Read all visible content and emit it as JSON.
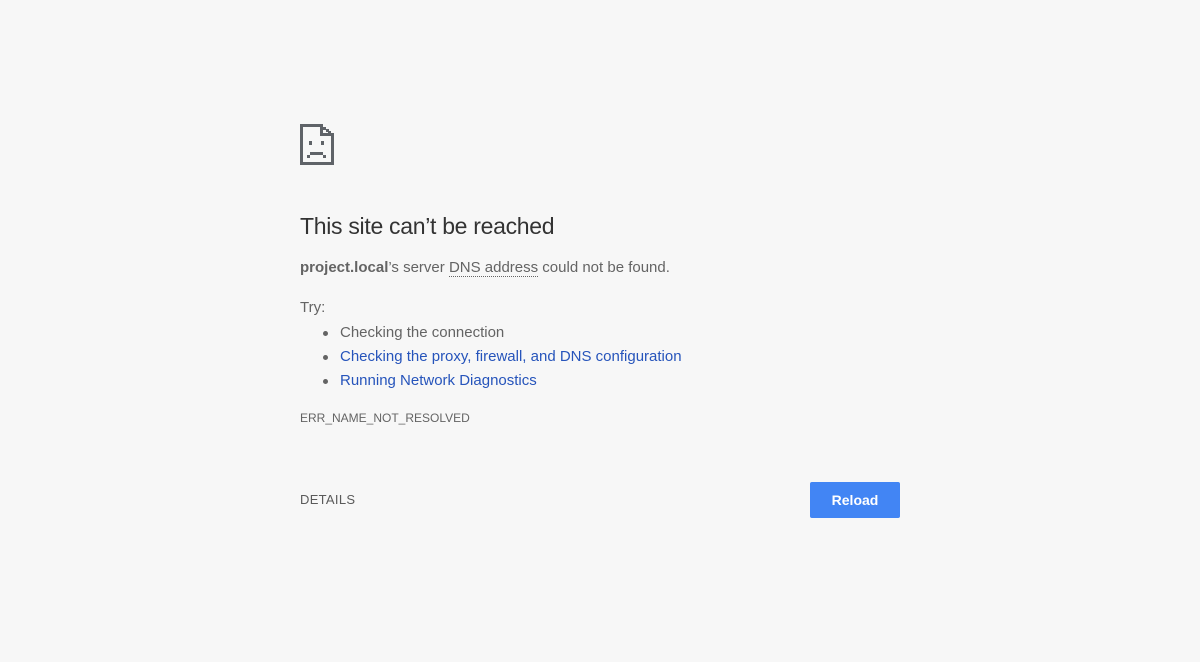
{
  "error_page": {
    "icon": "sad-document-icon",
    "heading": "This site can’t be reached",
    "summary": {
      "host": "project.local",
      "middle": "’s server ",
      "abbr": "DNS address",
      "tail": " could not be found."
    },
    "try_label": "Try:",
    "suggestions": [
      {
        "label": "Checking the connection",
        "is_link": false
      },
      {
        "label": "Checking the proxy, firewall, and DNS configuration",
        "is_link": true
      },
      {
        "label": "Running Network Diagnostics",
        "is_link": true
      }
    ],
    "error_code": "ERR_NAME_NOT_RESOLVED",
    "details_label": "DETAILS",
    "reload_label": "Reload"
  },
  "colors": {
    "background": "#f7f7f7",
    "heading": "#333333",
    "text": "#646464",
    "link": "#2654bb",
    "button": "#4285f4"
  }
}
